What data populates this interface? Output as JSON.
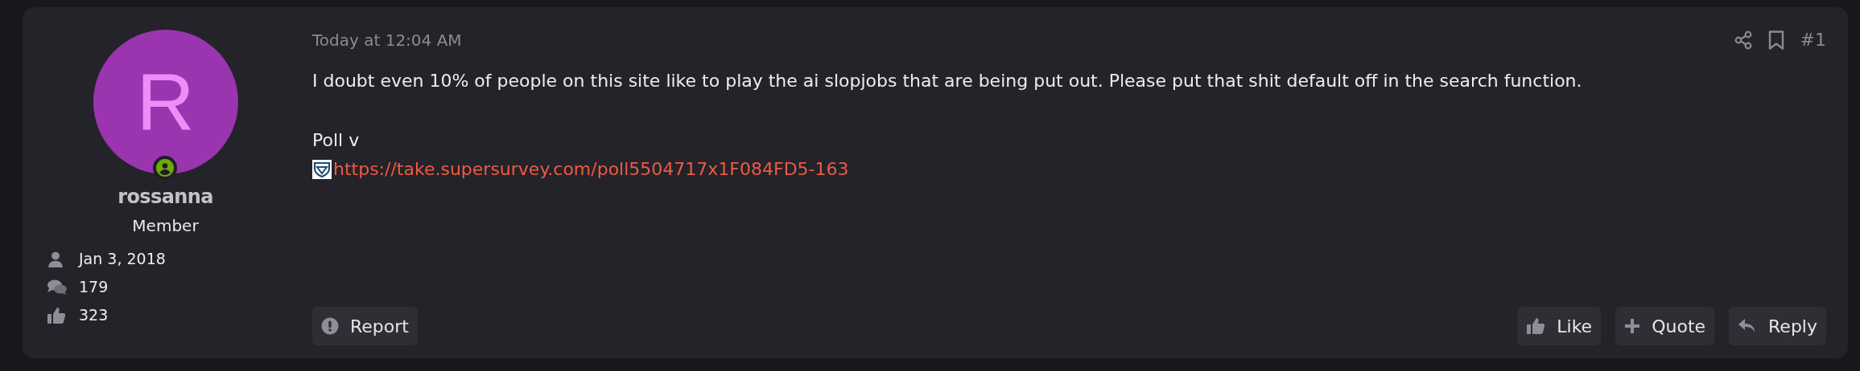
{
  "author": {
    "initial": "R",
    "name": "rossanna",
    "title": "Member",
    "online": true,
    "stats": [
      {
        "kind": "joined",
        "text": "Jan 3, 2018"
      },
      {
        "kind": "messages",
        "text": "179"
      },
      {
        "kind": "reactions",
        "text": "323"
      }
    ]
  },
  "post": {
    "time": "Today at 12:04 AM",
    "number": "#1",
    "body": "I doubt even 10% of people on this site like to play the ai slopjobs that are being put out. Please put that shit default off in the search function.",
    "poll_label": "Poll v",
    "link": "https://take.supersurvey.com/poll5504717x1F084FD5-163"
  },
  "actions_left": [
    {
      "kind": "report",
      "label": "Report"
    }
  ],
  "actions_right": [
    {
      "kind": "like",
      "label": "Like"
    },
    {
      "kind": "quote",
      "label": "Quote"
    },
    {
      "kind": "reply",
      "label": "Reply"
    }
  ]
}
